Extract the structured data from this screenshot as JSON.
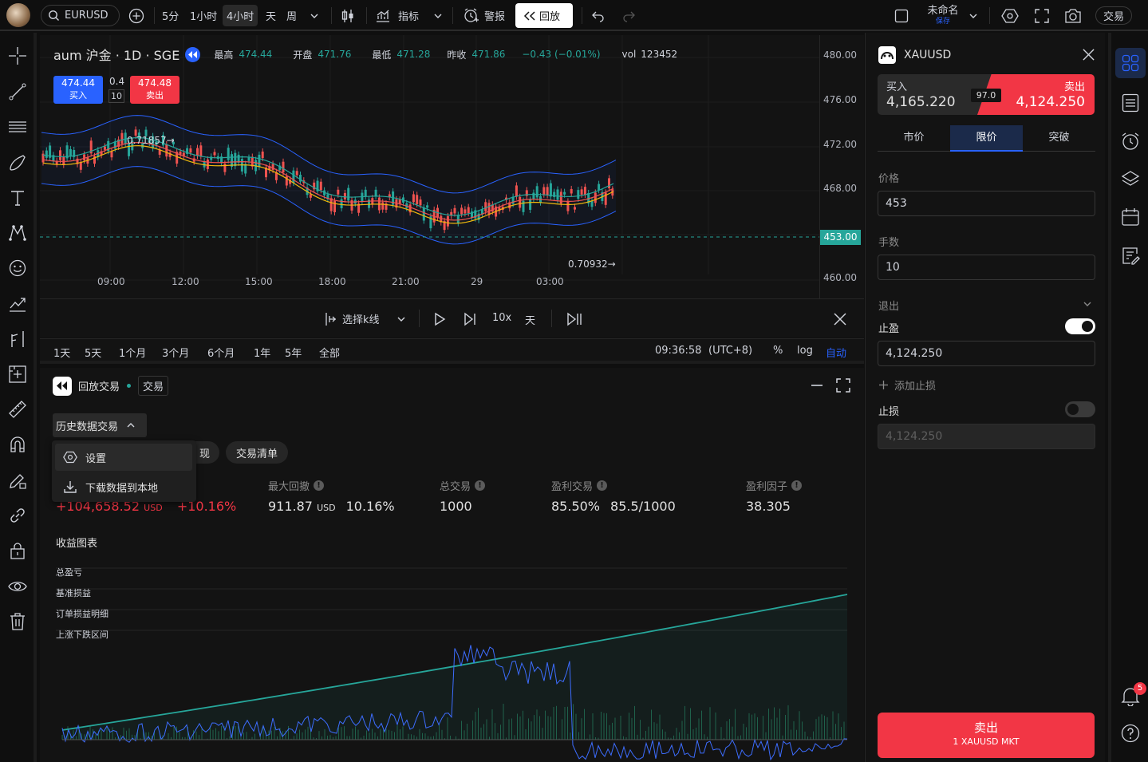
{
  "topbar": {
    "symbol": "EURUSD",
    "intervals": [
      "5分",
      "1小时",
      "4小时",
      "天",
      "周"
    ],
    "active_interval": "4小时",
    "indicators_label": "指标",
    "alert_label": "警报",
    "replay_label": "回放",
    "layout_name": "未命名",
    "layout_status": "保存",
    "trade_label": "交易"
  },
  "chart": {
    "symbol_title": "aum 沪金 · 1D · SGE",
    "stats": [
      {
        "label": "最高",
        "value": "474.44"
      },
      {
        "label": "开盘",
        "value": "471.76"
      },
      {
        "label": "最低",
        "value": "471.28"
      },
      {
        "label": "昨收",
        "value": "471.86"
      }
    ],
    "change": "−0.43 (−0.01%)",
    "vol_label": "vol",
    "vol_value": "123452",
    "buy_price": "474.44",
    "buy_label": "买入",
    "spread": "0.4",
    "qty": "10",
    "sell_price": "474.48",
    "sell_label": "卖出",
    "y_ticks": [
      "480.00",
      "476.00",
      "472.00",
      "468.00",
      "464.00",
      "460.00"
    ],
    "current_price": "453.00",
    "x_ticks": [
      "09:00",
      "12:00",
      "15:00",
      "18:00",
      "21:00",
      "29",
      "03:00"
    ],
    "annotation_high": "0.71857",
    "annotation_low": "0.70932"
  },
  "replay_bar": {
    "select_label": "选择k线",
    "speed": "10x",
    "unit": "天"
  },
  "range_bar": {
    "ranges": [
      "1天",
      "5天",
      "1个月",
      "3个月",
      "6个月",
      "1年",
      "5年",
      "全部"
    ],
    "time": "09:36:58",
    "timezone": "(UTC+8)",
    "percent": "%",
    "log": "log",
    "auto": "自动"
  },
  "bottom": {
    "title": "回放交易",
    "tag": "交易",
    "dropdown_label": "历史数据交易",
    "menu": [
      "设置",
      "下载数据到本地"
    ],
    "tab_partial": "现",
    "tab_list": "交易清单",
    "pnl_value": "+104,658.52",
    "pnl_unit": "USD",
    "pnl_pct": "+10.16%",
    "stats": [
      {
        "label": "最大回撤",
        "value": "911.87",
        "unit": "USD",
        "extra": "10.16%"
      },
      {
        "label": "总交易",
        "value": "1000"
      },
      {
        "label": "盈利交易",
        "value": "85.50%",
        "extra": "85.5/1000"
      },
      {
        "label": "盈利因子",
        "value": "38.305"
      }
    ],
    "chart_title": "收益图表",
    "legend": [
      "总盈亏",
      "基准损益",
      "订单损益明细",
      "上涨下跌区间"
    ]
  },
  "order": {
    "symbol": "XAUUSD",
    "buy_label": "买入",
    "buy_price": "4,165.220",
    "spread": "97.0",
    "sell_label": "卖出",
    "sell_price": "4,124.250",
    "tabs": [
      "市价",
      "限价",
      "突破"
    ],
    "active_tab": "限价",
    "price_label": "价格",
    "price_value": "453",
    "qty_label": "手数",
    "qty_value": "10",
    "exit_label": "退出",
    "tp_label": "止盈",
    "tp_value": "4,124.250",
    "add_sl_label": "添加止损",
    "sl_label": "止损",
    "sl_value": "4,124.250",
    "submit_title": "卖出",
    "submit_sub": "1 XAUUSD MKT"
  },
  "notifications_count": "5",
  "colors": {
    "up": "#26a69a",
    "down": "#ef5350",
    "accent": "#2962ff",
    "sell": "#f23645"
  }
}
